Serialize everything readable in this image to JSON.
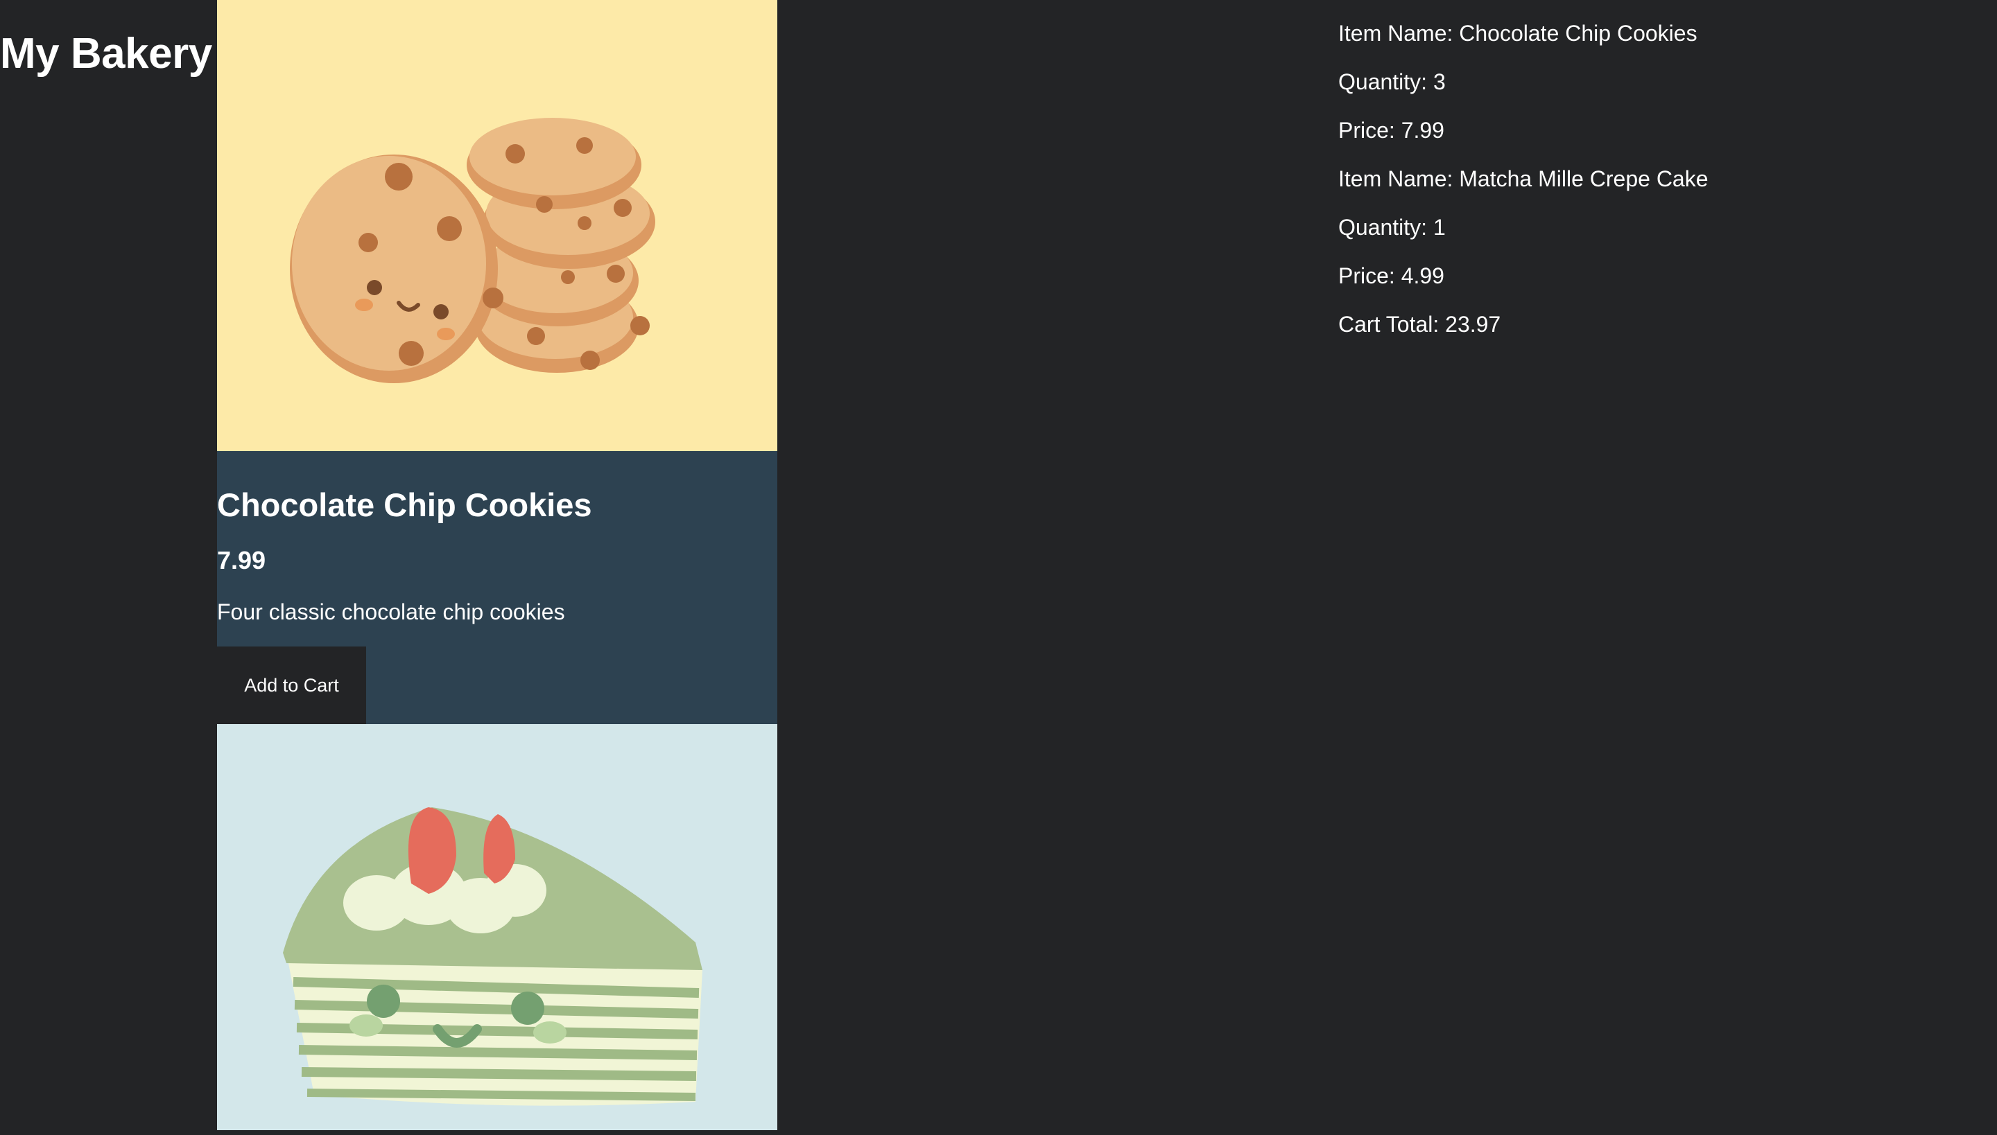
{
  "header": {
    "title": "My Bakery"
  },
  "products": [
    {
      "name": "Chocolate Chip Cookies",
      "price": "7.99",
      "description": "Four classic chocolate chip cookies",
      "button_label": "Add to Cart",
      "image_icon": "cookies-illustration",
      "image_bg": "#fdeaa8"
    },
    {
      "image_icon": "matcha-crepe-cake-illustration",
      "image_bg": "#d3e7ea"
    }
  ],
  "cart": {
    "items": [
      {
        "name_line": "Item Name: Chocolate Chip Cookies",
        "quantity_line": "Quantity: 3",
        "price_line": "Price: 7.99"
      },
      {
        "name_line": "Item Name: Matcha Mille Crepe Cake",
        "quantity_line": "Quantity: 1",
        "price_line": "Price: 4.99"
      }
    ],
    "total_line": "Cart Total: 23.97"
  },
  "colors": {
    "page_bg": "#232426",
    "card_bg": "#2d4251",
    "text": "#ffffff",
    "button_bg": "#232426"
  }
}
